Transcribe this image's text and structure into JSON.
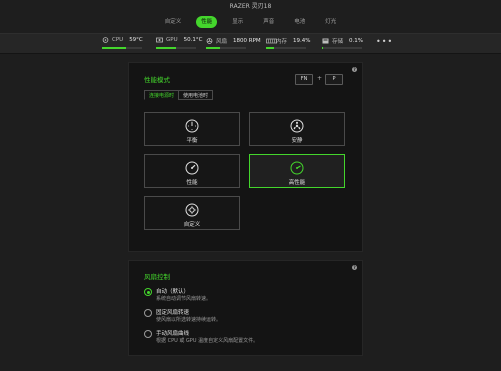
{
  "window": {
    "title": "RAZER 灵刃18"
  },
  "tabs": [
    {
      "label": "自定义"
    },
    {
      "label": "性能"
    },
    {
      "label": "显示"
    },
    {
      "label": "声音"
    },
    {
      "label": "电池"
    },
    {
      "label": "灯光"
    }
  ],
  "active_tab": "性能",
  "stats": {
    "cpu": {
      "label": "CPU",
      "value": "59°C",
      "level_pct": 59
    },
    "gpu": {
      "label": "GPU",
      "value": "50.1°C",
      "level_pct": 50
    },
    "fan": {
      "label": "风扇",
      "value": "1800 RPM",
      "level_pct": 35
    },
    "memory": {
      "label": "内存",
      "value": "19.4%",
      "level_pct": 19
    },
    "storage": {
      "label": "存储",
      "value": "0.1%",
      "level_pct": 1
    },
    "more_label": "•••"
  },
  "performance": {
    "title": "性能模式",
    "help": "?",
    "hotkey": {
      "key1": "FN",
      "plus": "+",
      "key2": "P"
    },
    "power_tabs": [
      {
        "label": "连接电源时"
      },
      {
        "label": "使用电池时"
      }
    ],
    "modes": [
      {
        "label": "平衡",
        "icon": "gauge-icon"
      },
      {
        "label": "安静",
        "icon": "fan-icon"
      },
      {
        "label": "性能",
        "icon": "speedometer-icon"
      },
      {
        "label": "高性能",
        "icon": "speedometer-icon"
      },
      {
        "label": "自定义",
        "icon": "gear-icon"
      }
    ],
    "selected_mode": "高性能"
  },
  "fan_control": {
    "title": "风扇控制",
    "help": "?",
    "options": [
      {
        "title": "自动（默认）",
        "desc": "系统自动调节风扇转速。",
        "selected": true
      },
      {
        "title": "固定风扇转速",
        "desc": "使风扇以所选转速持续运转。",
        "selected": false
      },
      {
        "title": "手动风扇曲线",
        "desc": "根据 CPU 或 GPU 温度自定义风扇配置文件。",
        "selected": false
      }
    ]
  },
  "colors": {
    "accent": "#44d62c",
    "background": "#1e1e1e",
    "panel": "#141414"
  }
}
